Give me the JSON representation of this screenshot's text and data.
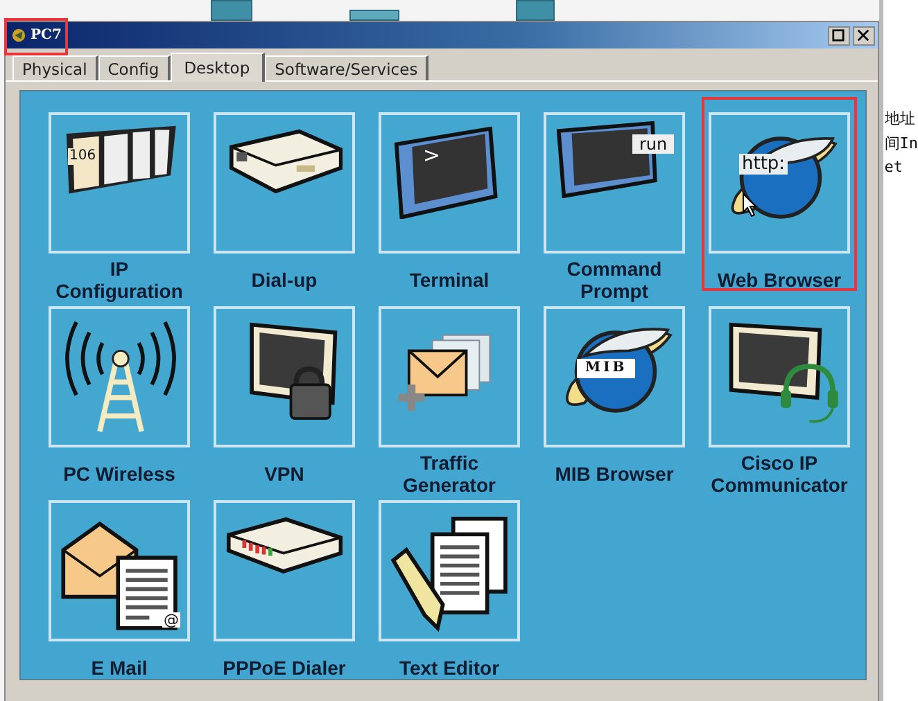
{
  "window": {
    "title": "PC7",
    "title_highlighted": true
  },
  "tabs": [
    {
      "label": "Physical",
      "selected": false
    },
    {
      "label": "Config",
      "selected": false
    },
    {
      "label": "Desktop",
      "selected": true
    },
    {
      "label": "Software/Services",
      "selected": false
    }
  ],
  "apps": [
    {
      "kind": "ip",
      "label": "IP Configuration",
      "icon_text": "106",
      "highlighted": false
    },
    {
      "kind": "dialup",
      "label": "Dial-up",
      "highlighted": false
    },
    {
      "kind": "terminal",
      "label": "Terminal",
      "icon_text": ">",
      "highlighted": false
    },
    {
      "kind": "command",
      "label": "Command Prompt",
      "icon_text": "run",
      "highlighted": false
    },
    {
      "kind": "web",
      "label": "Web Browser",
      "icon_text": "http:",
      "highlighted": true
    },
    {
      "kind": "wireless",
      "label": "PC Wireless",
      "highlighted": false
    },
    {
      "kind": "vpn",
      "label": "VPN",
      "highlighted": false
    },
    {
      "kind": "traffic",
      "label": "Traffic Generator",
      "highlighted": false
    },
    {
      "kind": "mib",
      "label": "MIB Browser",
      "icon_text": "MIB",
      "highlighted": false
    },
    {
      "kind": "phone",
      "label": "Cisco IP Communicator",
      "highlighted": false
    },
    {
      "kind": "email",
      "label": "E Mail",
      "icon_text": "@",
      "highlighted": false
    },
    {
      "kind": "pppoe",
      "label": "PPPoE Dialer",
      "highlighted": false
    },
    {
      "kind": "editor",
      "label": "Text Editor",
      "highlighted": false
    }
  ],
  "background_window": {
    "lines": [
      "地址",
      "间In",
      "et"
    ]
  }
}
